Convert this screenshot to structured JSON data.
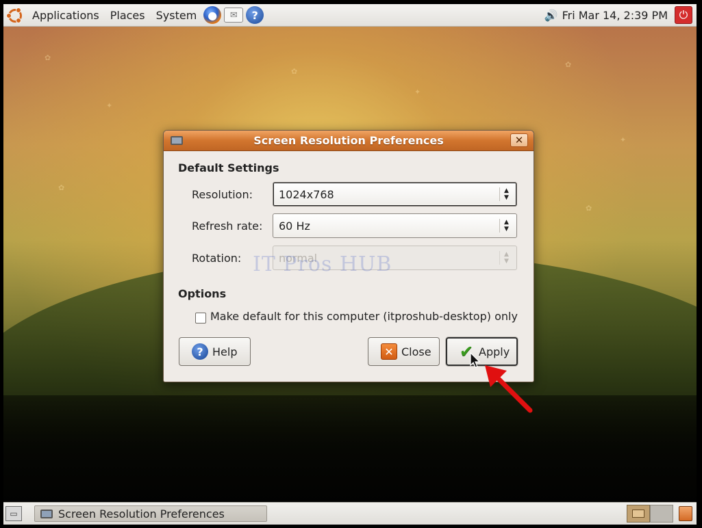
{
  "top_panel": {
    "menus": [
      "Applications",
      "Places",
      "System"
    ],
    "launchers": [
      "firefox-icon",
      "mail-icon",
      "help-icon"
    ],
    "clock": "Fri Mar 14,  2:39 PM",
    "icons": {
      "volume": "speaker-icon",
      "shutdown": "power-icon"
    }
  },
  "dialog": {
    "title": "Screen Resolution Preferences",
    "close_symbol": "✕",
    "default_settings_heading": "Default Settings",
    "resolution": {
      "label": "Resolution:",
      "value": "1024x768"
    },
    "refresh_rate": {
      "label": "Refresh rate:",
      "value": "60 Hz"
    },
    "rotation": {
      "label": "Rotation:",
      "value": "normal",
      "enabled": false
    },
    "options_heading": "Options",
    "make_default": {
      "label": "Make default for this computer (itproshub-desktop) only",
      "checked": false
    },
    "buttons": {
      "help": "Help",
      "close": "Close",
      "apply": "Apply"
    },
    "watermark": "IT Pros HUB"
  },
  "bottom_panel": {
    "task_title": "Screen Resolution Preferences",
    "workspaces": 2
  },
  "colors": {
    "title_gradient_top": "#f0a463",
    "title_gradient_bottom": "#c06624",
    "annotation_arrow": "#e01010"
  }
}
